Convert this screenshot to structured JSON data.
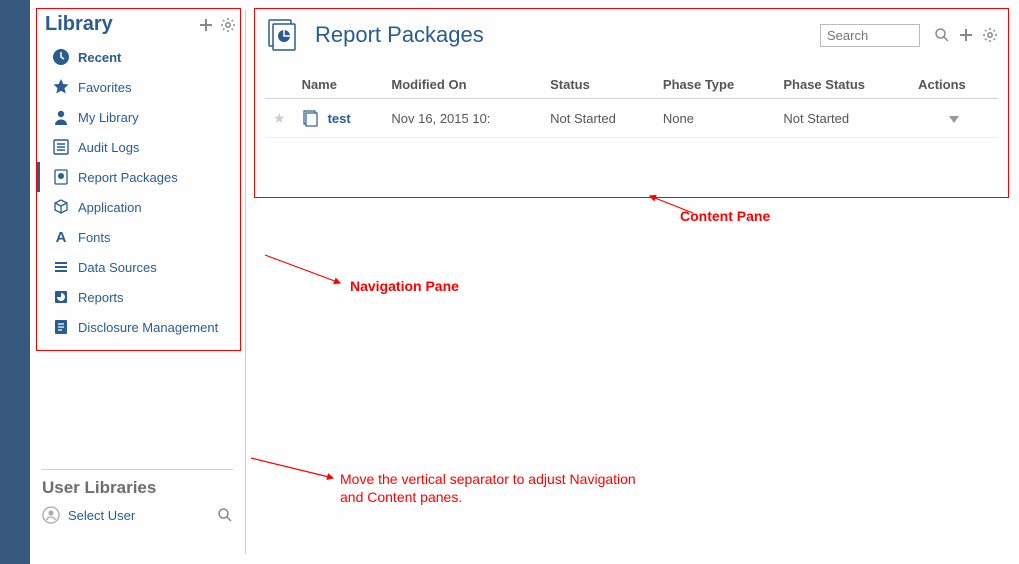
{
  "sidebar": {
    "title": "Library",
    "items": [
      {
        "label": "Recent",
        "icon": "clock"
      },
      {
        "label": "Favorites",
        "icon": "star"
      },
      {
        "label": "My Library",
        "icon": "person"
      },
      {
        "label": "Audit Logs",
        "icon": "list"
      },
      {
        "label": "Report Packages",
        "icon": "report-pkg"
      },
      {
        "label": "Application",
        "icon": "cube"
      },
      {
        "label": "Fonts",
        "icon": "font"
      },
      {
        "label": "Data Sources",
        "icon": "datasource"
      },
      {
        "label": "Reports",
        "icon": "report"
      },
      {
        "label": "Disclosure Management",
        "icon": "disclosure"
      }
    ],
    "user_libraries_title": "User Libraries",
    "select_user_label": "Select User"
  },
  "content": {
    "title": "Report Packages",
    "search_placeholder": "Search",
    "columns": {
      "name": "Name",
      "modified_on": "Modified On",
      "status": "Status",
      "phase_type": "Phase Type",
      "phase_status": "Phase Status",
      "actions": "Actions"
    },
    "rows": [
      {
        "name": "test",
        "modified_on": "Nov 16, 2015 10:",
        "status": "Not Started",
        "phase_type": "None",
        "phase_status": "Not Started"
      }
    ]
  },
  "annotations": {
    "nav_pane": "Navigation Pane",
    "content_pane": "Content Pane",
    "separator": "Move the vertical separator to adjust Navigation and Content panes."
  }
}
